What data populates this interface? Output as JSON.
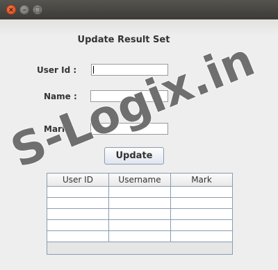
{
  "window": {
    "controls": [
      {
        "name": "close-icon",
        "glyph": "×"
      },
      {
        "name": "minimize-icon",
        "glyph": "–"
      },
      {
        "name": "maximize-icon",
        "glyph": "□"
      }
    ]
  },
  "form": {
    "heading": "Update Result Set",
    "user_id_label": "User Id :",
    "user_id_value": "",
    "name_label": "Name :",
    "name_value": "",
    "mark_label": "Mark :",
    "mark_value": "",
    "update_button": "Update"
  },
  "table": {
    "columns": [
      "User ID",
      "Username",
      "Mark"
    ],
    "rows": [
      [
        "",
        "",
        ""
      ],
      [
        "",
        "",
        ""
      ],
      [
        "",
        "",
        ""
      ],
      [
        "",
        "",
        ""
      ],
      [
        "",
        "",
        ""
      ]
    ]
  },
  "watermark": {
    "text": "S-Logix.in",
    "color": "#6f6f6f"
  }
}
